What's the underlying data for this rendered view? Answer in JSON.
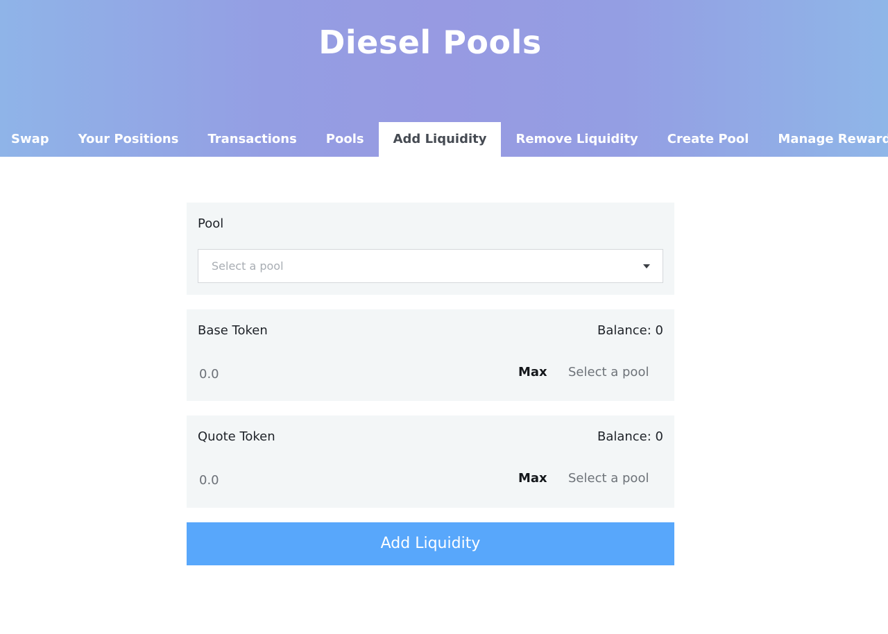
{
  "header": {
    "title": "Diesel Pools"
  },
  "nav": {
    "tabs": [
      {
        "label": "Swap"
      },
      {
        "label": "Your Positions"
      },
      {
        "label": "Transactions"
      },
      {
        "label": "Pools"
      },
      {
        "label": "Add Liquidity"
      },
      {
        "label": "Remove Liquidity"
      },
      {
        "label": "Create Pool"
      },
      {
        "label": "Manage Rewards"
      }
    ],
    "active": "Add Liquidity"
  },
  "pool": {
    "label": "Pool",
    "placeholder": "Select a pool"
  },
  "base_token": {
    "label": "Base Token",
    "balance": "Balance: 0",
    "amount_placeholder": "0.0",
    "max_label": "Max",
    "token_label": "Select a pool"
  },
  "quote_token": {
    "label": "Quote Token",
    "balance": "Balance: 0",
    "amount_placeholder": "0.0",
    "max_label": "Max",
    "token_label": "Select a pool"
  },
  "submit": {
    "label": "Add Liquidity"
  },
  "colors": {
    "accent": "#58a7fb",
    "header_gradient_start": "#8fb4e8",
    "header_gradient_mid": "#979ae2",
    "card_background": "#f3f6f7"
  },
  "icons": {
    "pool_select_caret": "caret-down-icon"
  }
}
